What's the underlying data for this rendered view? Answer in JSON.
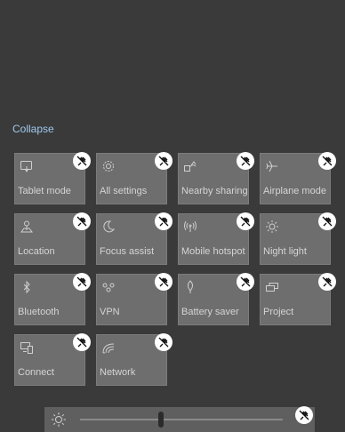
{
  "action_center": {
    "collapse_label": "Collapse",
    "tiles": [
      {
        "label": "Tablet mode",
        "icon": "tablet-mode-icon"
      },
      {
        "label": "All settings",
        "icon": "gear-icon"
      },
      {
        "label": "Nearby sharing",
        "icon": "nearby-sharing-icon"
      },
      {
        "label": "Airplane mode",
        "icon": "airplane-icon"
      },
      {
        "label": "Location",
        "icon": "location-icon"
      },
      {
        "label": "Focus assist",
        "icon": "moon-icon"
      },
      {
        "label": "Mobile hotspot",
        "icon": "hotspot-icon"
      },
      {
        "label": "Night light",
        "icon": "sun-icon"
      },
      {
        "label": "Bluetooth",
        "icon": "bluetooth-icon"
      },
      {
        "label": "VPN",
        "icon": "vpn-icon"
      },
      {
        "label": "Battery saver",
        "icon": "leaf-icon"
      },
      {
        "label": "Project",
        "icon": "project-icon"
      },
      {
        "label": "Connect",
        "icon": "connect-icon"
      },
      {
        "label": "Network",
        "icon": "wifi-icon"
      }
    ],
    "brightness": {
      "icon": "brightness-icon",
      "level_fraction": 0.4
    },
    "unpin_icon": "unpin-icon"
  },
  "colors": {
    "background": "#3a3a3a",
    "tile": "#6e6e6e",
    "tile_text": "#d4d4d4",
    "link": "#9fc8ee",
    "unpin_badge": "#ffffff"
  }
}
